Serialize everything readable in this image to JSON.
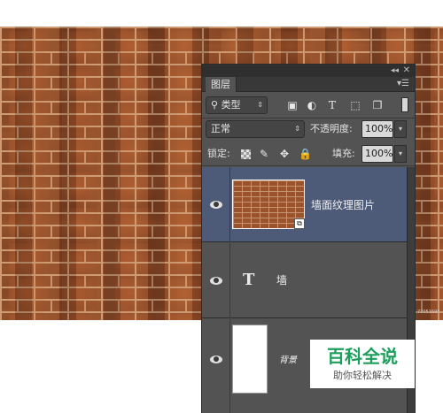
{
  "panel": {
    "title": "图层",
    "collapse_icon": "double-chevron-left-icon",
    "close_icon": "close-icon",
    "menu_icon": "panel-menu-icon"
  },
  "filter": {
    "kind_label": "类型",
    "icons": [
      "image-filter-icon",
      "adjustment-filter-icon",
      "type-filter-icon",
      "shape-filter-icon",
      "smart-object-filter-icon"
    ]
  },
  "blend": {
    "mode": "正常",
    "opacity_label": "不透明度:",
    "opacity_value": "100%"
  },
  "lock": {
    "label": "锁定:",
    "fill_label": "填充:",
    "fill_value": "100%"
  },
  "layers": [
    {
      "name": "墙面纹理图片",
      "kind": "smart-object",
      "selected": true,
      "visible": true
    },
    {
      "name": "墙",
      "kind": "text",
      "selected": false,
      "visible": true
    },
    {
      "name": "背景",
      "kind": "background",
      "selected": false,
      "visible": true
    }
  ],
  "watermark": {
    "title": "百科全说",
    "subtitle": "助你轻松解决"
  },
  "corner_mark": "72051598",
  "colors": {
    "panel_bg": "#535353",
    "selected_layer": "#4d5a78",
    "watermark_green": "#1e9e5c"
  }
}
